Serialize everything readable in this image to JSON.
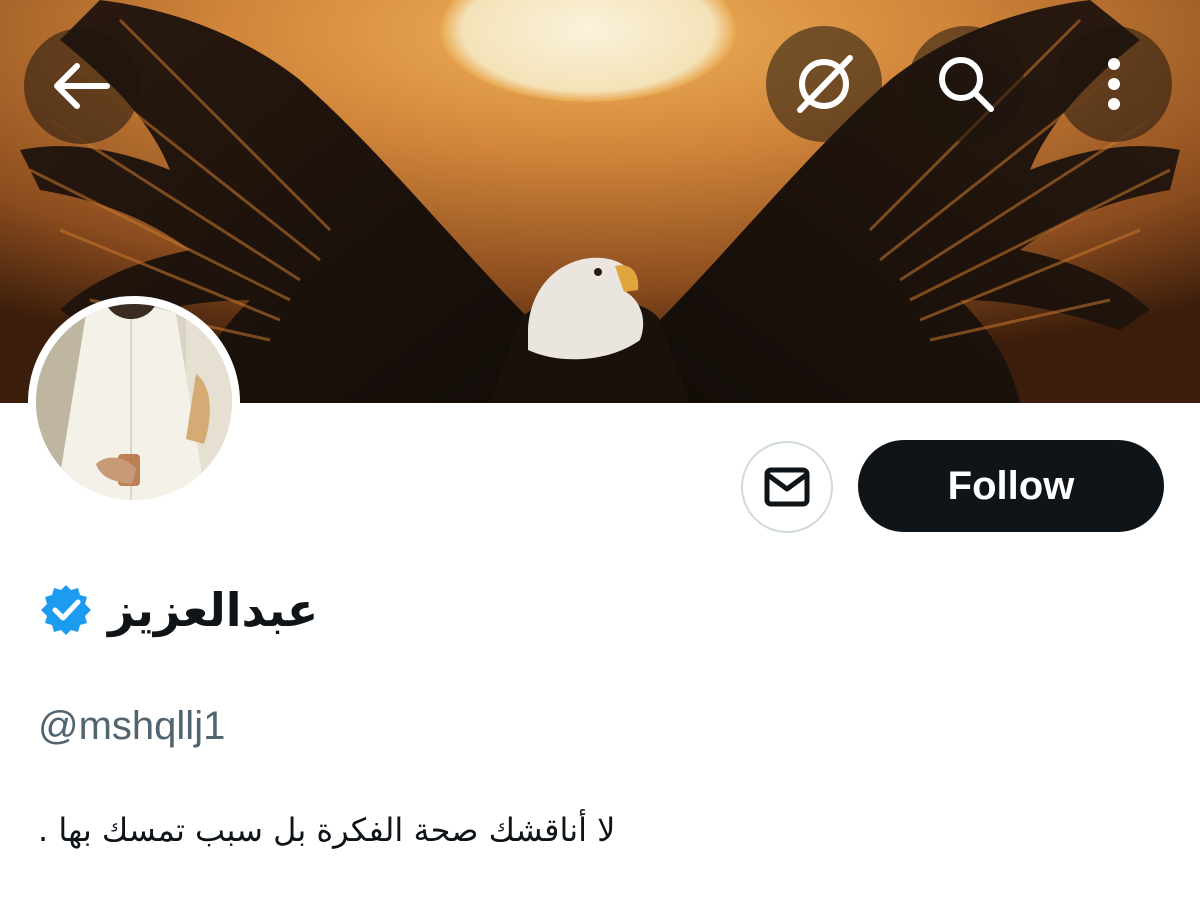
{
  "header": {
    "back_icon": "arrow-left-icon",
    "grok_icon": "grok-icon",
    "search_icon": "search-icon",
    "more_icon": "more-vertical-icon"
  },
  "banner": {
    "description": "",
    "colors": {
      "sky": "#d68a3c",
      "sun": "#f6e8c6",
      "wing": "#1c130e"
    }
  },
  "actions": {
    "message_icon": "mail-icon",
    "follow_label": "Follow"
  },
  "profile": {
    "display_name": "عبدالعزيز",
    "verified_icon": "verified-badge-icon",
    "verified_color": "#1d9bf0",
    "handle": "@mshqllj1",
    "bio": "لا أناقشك  صحة الفكرة بل سبب تمسك بها ."
  }
}
